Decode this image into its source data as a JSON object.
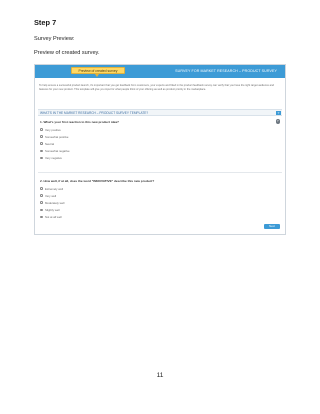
{
  "document": {
    "step_heading": "Step 7",
    "subheading": "Survey Preview:",
    "caption": "Preview of created survey.",
    "page_number": "11"
  },
  "survey": {
    "callout": "Preview of created survey",
    "title": "SURVEY FOR MARKET RESEARCH – PRODUCT SURVEY",
    "intro": "To help ensure a successful product launch, it's important that you get feedback from customers, your experts and fitted in the product feedback survey can verify that you have the right target audience and features for your new product. This template will give you input for what people think of your offering as well as product priority in the marketplace.",
    "section_title": "WHAT'S IN THE MARKET RESEARCH – PRODUCT SURVEY TEMPLATE?",
    "section_info": "?",
    "help_icon_text": "?",
    "questions": [
      {
        "text": "1.  What's your first reaction to this new product idea?",
        "options": [
          "Very positive",
          "Somewhat positive",
          "Neutral",
          "Somewhat negative",
          "Very negative"
        ]
      },
      {
        "text": "2.  How well, if at all, does the word \"INNOVATIVE\" describe this new product?",
        "options": [
          "Extremely well",
          "Very well",
          "Moderately well",
          "Slightly well",
          "Not at all well"
        ]
      }
    ],
    "next_label": "Next"
  },
  "colors": {
    "header_blue": "#3d9bd6",
    "callout_yellow": "#ffd863",
    "section_text": "#3d6fa3"
  }
}
